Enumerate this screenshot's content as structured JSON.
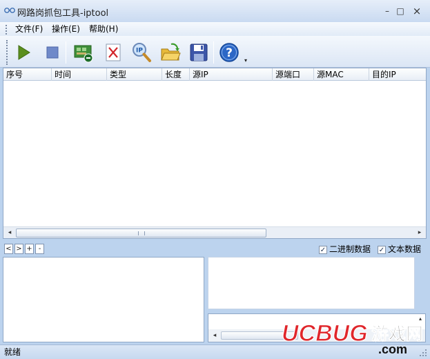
{
  "window": {
    "title": "网路岗抓包工具-iptool",
    "minimize": "–",
    "maximize": "□",
    "close": "×"
  },
  "menu": [
    "文件(F)",
    "操作(E)",
    "帮助(H)"
  ],
  "toolbar": {
    "buttons": [
      "start-icon",
      "stop-icon",
      "network-adapter-icon",
      "clear-icon",
      "ip-search-icon",
      "open-folder-icon",
      "save-icon",
      "help-icon"
    ],
    "more": "▾"
  },
  "grid": {
    "columns": [
      "序号",
      "时间",
      "类型",
      "长度",
      "源IP",
      "源端口",
      "源MAC",
      "目的IP"
    ],
    "rows": [],
    "scroll_left": "◂",
    "scroll_right": "▸"
  },
  "nav_buttons": [
    "<",
    ">",
    "+",
    "-"
  ],
  "options": {
    "binary": {
      "label": "二进制数据",
      "checked": true,
      "mark": "✓"
    },
    "text": {
      "label": "文本数据",
      "checked": true,
      "mark": "✓"
    }
  },
  "detail": {
    "scroll_left": "◂",
    "scroll_up": "▴"
  },
  "status": {
    "text": "就绪"
  },
  "watermark": {
    "brand": "UCBUG",
    "cn": "游戏网",
    "domain": ".com"
  },
  "colors": {
    "accent": "#1f5aa8",
    "toolbar_bg": "#dbe6f5",
    "watermark_red": "#e0262b"
  }
}
